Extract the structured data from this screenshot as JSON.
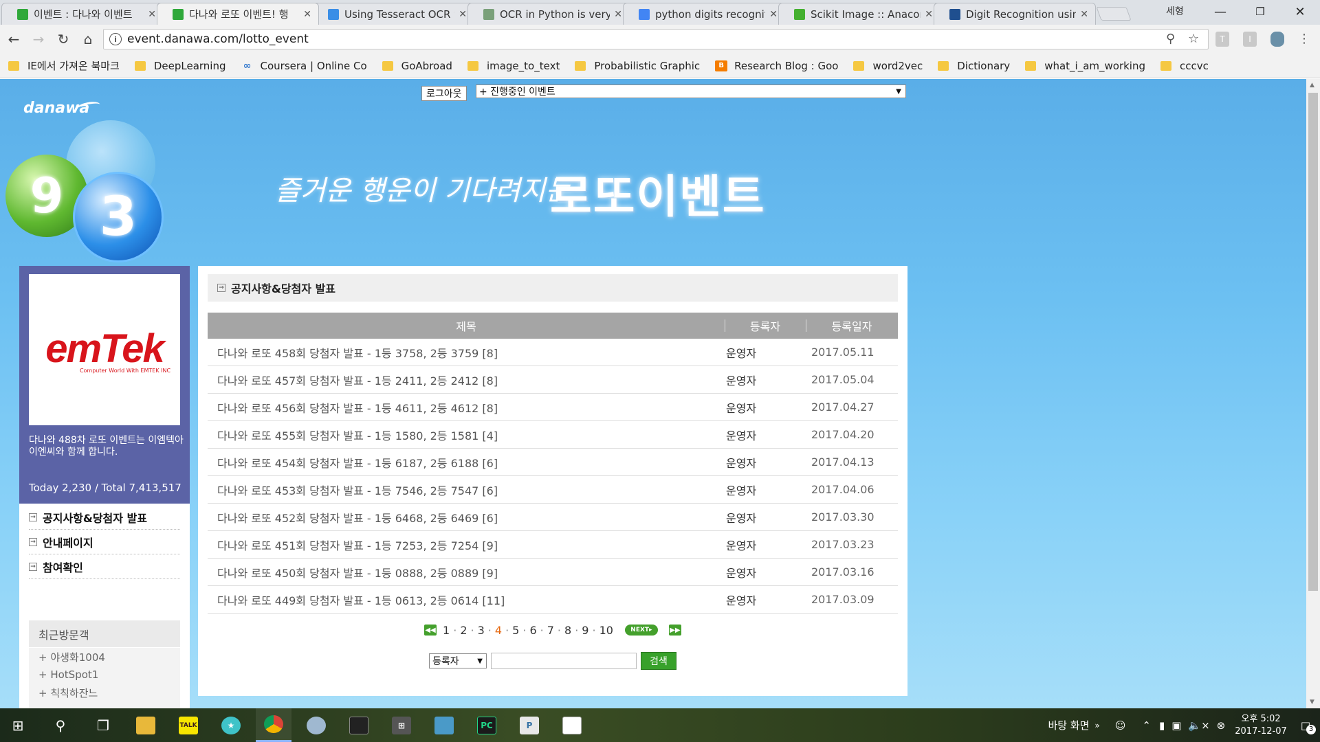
{
  "browser": {
    "tabs": [
      {
        "title": "이벤트 : 다나와 이벤트",
        "icon": "danawa-icon",
        "color": "#2fa83a",
        "active": false
      },
      {
        "title": "다나와 로또 이벤트! 행",
        "icon": "danawa-icon",
        "color": "#2fa83a",
        "active": true
      },
      {
        "title": "Using Tesseract OCR w",
        "icon": "p-icon",
        "color": "#3a8ee6",
        "active": false
      },
      {
        "title": "OCR in Python is very",
        "icon": "page-icon",
        "color": "#7aa07a",
        "active": false
      },
      {
        "title": "python digits recognit",
        "icon": "google-icon",
        "color": "#4285f4",
        "active": false
      },
      {
        "title": "Scikit Image :: Anacon",
        "icon": "circle-icon",
        "color": "#44b030",
        "active": false
      },
      {
        "title": "Digit Recognition usin",
        "icon": "ht-icon",
        "color": "#1f4f8f",
        "active": false
      }
    ],
    "user": "세형",
    "url": "event.danawa.com/lotto_event",
    "bookmarks": [
      {
        "label": "IE에서 가져온 북마크",
        "type": "folder"
      },
      {
        "label": "DeepLearning",
        "type": "folder"
      },
      {
        "label": "Coursera | Online Co",
        "type": "coursera"
      },
      {
        "label": "GoAbroad",
        "type": "folder"
      },
      {
        "label": "image_to_text",
        "type": "folder"
      },
      {
        "label": "Probabilistic Graphic",
        "type": "folder"
      },
      {
        "label": "Research Blog : Goo",
        "type": "blogger"
      },
      {
        "label": "word2vec",
        "type": "folder"
      },
      {
        "label": "Dictionary",
        "type": "folder"
      },
      {
        "label": "what_i_am_working",
        "type": "folder"
      },
      {
        "label": "cccvc",
        "type": "folder"
      }
    ]
  },
  "site": {
    "logout": "로그아웃",
    "event_select": "+ 진행중인 이벤트",
    "brand": "danawa",
    "slogan": "즐거운 행운이 기다려지는",
    "title": "로또이벤트",
    "balls": [
      "9",
      "3"
    ]
  },
  "sidebar": {
    "sponsor_logo": "emTek",
    "sponsor_tagline": "Computer World With EMTEK INC",
    "description": "다나와 488차 로또 이벤트는 이엠텍아이엔씨와 함께 합니다.",
    "counter": "Today 2,230 / Total 7,413,517",
    "menu": [
      "공지사항&당첨자 발표",
      "안내페이지",
      "참여확인"
    ],
    "recent_title": "최근방문객",
    "recent_visitors": [
      "+ 야생화1004",
      "+ HotSpot1",
      "+ 칙칙하잔느"
    ]
  },
  "main": {
    "section_title": "공지사항&당첨자 발표",
    "columns": [
      "제목",
      "등록자",
      "등록일자"
    ],
    "rows": [
      {
        "title": "다나와 로또 458회 당첨자 발표 - 1등 3758, 2등 3759 [8]",
        "author": "운영자",
        "date": "2017.05.11"
      },
      {
        "title": "다나와 로또 457회 당첨자 발표 - 1등 2411, 2등 2412 [8]",
        "author": "운영자",
        "date": "2017.05.04"
      },
      {
        "title": "다나와 로또 456회 당첨자 발표 - 1등 4611, 2등 4612 [8]",
        "author": "운영자",
        "date": "2017.04.27"
      },
      {
        "title": "다나와 로또 455회 당첨자 발표 - 1등 1580, 2등 1581 [4]",
        "author": "운영자",
        "date": "2017.04.20"
      },
      {
        "title": "다나와 로또 454회 당첨자 발표 - 1등 6187, 2등 6188 [6]",
        "author": "운영자",
        "date": "2017.04.13"
      },
      {
        "title": "다나와 로또 453회 당첨자 발표 - 1등 7546, 2등 7547 [6]",
        "author": "운영자",
        "date": "2017.04.06"
      },
      {
        "title": "다나와 로또 452회 당첨자 발표 - 1등 6468, 2등 6469 [6]",
        "author": "운영자",
        "date": "2017.03.30"
      },
      {
        "title": "다나와 로또 451회 당첨자 발표 - 1등 7253, 2등 7254 [9]",
        "author": "운영자",
        "date": "2017.03.23"
      },
      {
        "title": "다나와 로또 450회 당첨자 발표 - 1등 0888, 2등 0889 [9]",
        "author": "운영자",
        "date": "2017.03.16"
      },
      {
        "title": "다나와 로또 449회 당첨자 발표 - 1등 0613, 2등 0614 [11]",
        "author": "운영자",
        "date": "2017.03.09"
      }
    ],
    "pages": [
      "1",
      "2",
      "3",
      "4",
      "5",
      "6",
      "7",
      "8",
      "9",
      "10"
    ],
    "current_page": "4",
    "next_label": "NEXT",
    "search_field": "등록자",
    "search_value": "",
    "search_button": "검색"
  },
  "taskbar": {
    "desktop_label": "바탕 화면",
    "time": "오후 5:02",
    "date": "2017-12-07",
    "notifications": "3"
  },
  "colors": {
    "accent_green": "#44a02c",
    "sidebar_purple": "#5b63a6",
    "table_header": "#a5a5a5",
    "current_page": "#e66a12"
  }
}
